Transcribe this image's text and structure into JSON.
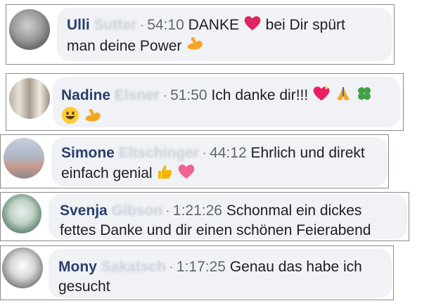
{
  "comments": [
    {
      "first_name": "Ulli",
      "last_name": "Sutter",
      "separator": "·",
      "timestamp": "54:10",
      "line1_text": "DANKE",
      "line1_after": "bei Dir spürt",
      "line2_text": "man deine Power",
      "emojis": [
        "heart-emoji",
        "flexed-biceps-emoji"
      ]
    },
    {
      "first_name": "Nadine",
      "last_name": "Elsner",
      "separator": "·",
      "timestamp": "51:50",
      "line1_text": "Ich danke dir!!!",
      "line2_text": "",
      "emojis": [
        "sparkling-heart-emoji",
        "folded-hands-emoji",
        "four-leaf-clover-emoji",
        "grinning-face-emoji",
        "flexed-biceps-emoji"
      ]
    },
    {
      "first_name": "Simone",
      "last_name": "Eltschinger",
      "separator": "·",
      "timestamp": "44:12",
      "line1_text": "Ehrlich und direkt",
      "line2_text": "einfach genial",
      "emojis": [
        "thumbs-up-emoji",
        "pink-heart-emoji"
      ]
    },
    {
      "first_name": "Svenja",
      "last_name": "Gibson",
      "separator": "·",
      "timestamp": "1:21:26",
      "line1_text": "Schonmal ein dickes",
      "line2_text": "fettes Danke und dir einen schönen Feierabend",
      "emojis": []
    },
    {
      "first_name": "Mony",
      "last_name": "Sakatsch",
      "separator": "·",
      "timestamp": "1:17:25",
      "line1_text": "Genau das habe ich",
      "line2_text": "gesucht",
      "emojis": []
    }
  ],
  "colors": {
    "name": "#2b3f6c",
    "bubble": "#f0f2f5",
    "heart": "#e0245e",
    "biceps": "#f4a623"
  }
}
